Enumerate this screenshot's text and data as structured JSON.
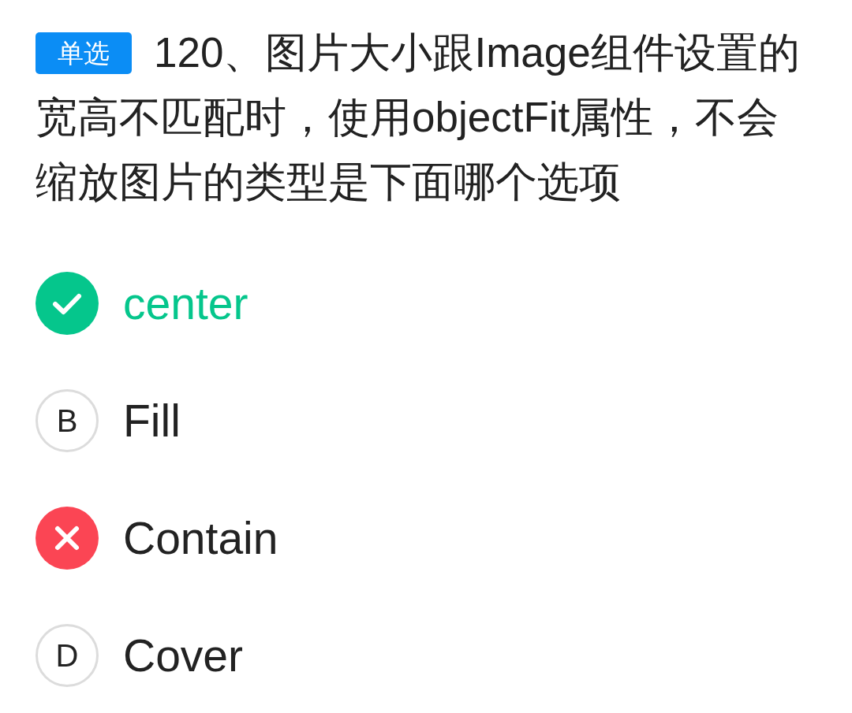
{
  "question": {
    "type_badge": "单选",
    "lines": [
      "120、图片大小跟Image组件设置的",
      "宽高不匹配时，使用objectFit属性，不会",
      "缩放图片的类型是下面哪个选项"
    ]
  },
  "options": [
    {
      "kind": "correct",
      "text": "center"
    },
    {
      "kind": "plain",
      "letter": "B",
      "text": "Fill"
    },
    {
      "kind": "wrong",
      "text": "Contain"
    },
    {
      "kind": "plain",
      "letter": "D",
      "text": "Cover"
    }
  ]
}
